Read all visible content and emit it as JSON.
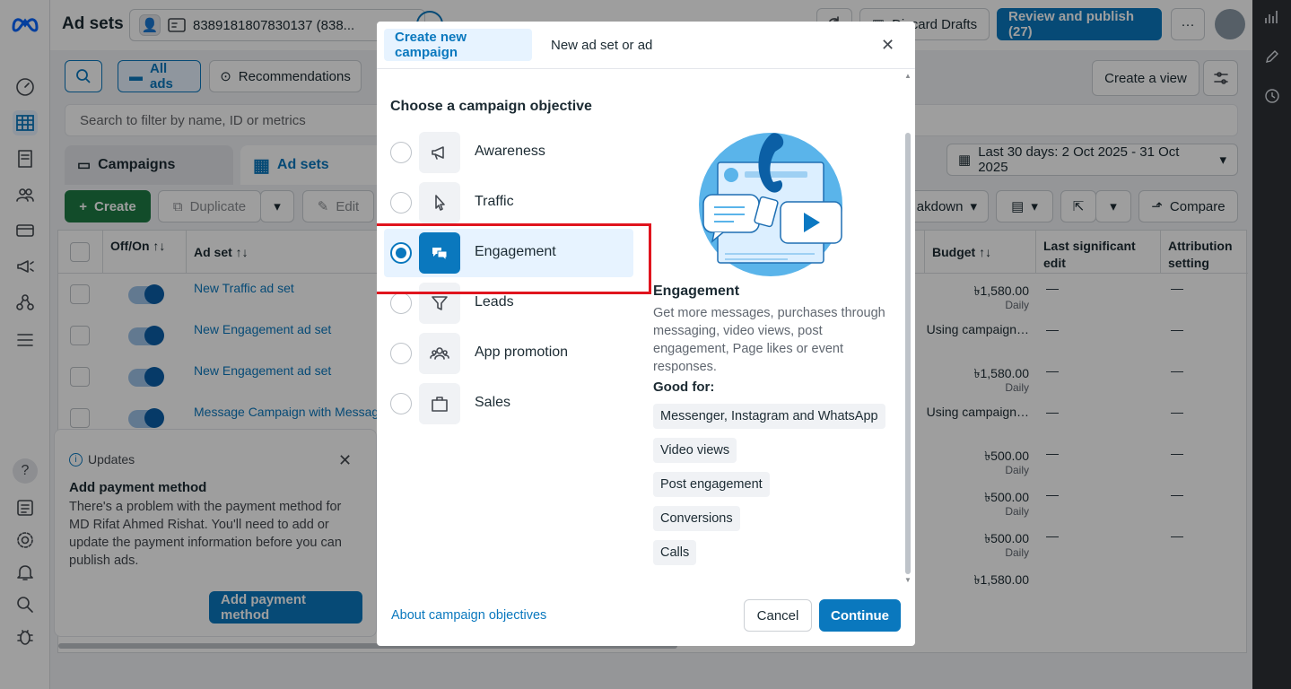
{
  "topbar": {
    "title": "Ad sets",
    "account_id": "8389181807830137 (838...",
    "discard_drafts": "Discard Drafts",
    "review_publish": "Review and publish (27)",
    "more": "···"
  },
  "toolbar": {
    "all_ads": "All ads",
    "recommendations": "Recommendations",
    "create_view": "Create a view",
    "search_placeholder": "Search to filter by name, ID or metrics"
  },
  "level_tabs": {
    "campaigns": "Campaigns",
    "ad_sets": "Ad sets"
  },
  "date_range": "Last 30 days: 2 Oct 2025 - 31 Oct 2025",
  "actions": {
    "create": "Create",
    "duplicate": "Duplicate",
    "edit": "Edit",
    "breakdown": "akdown",
    "compare": "Compare"
  },
  "table": {
    "headers": {
      "off_on": "Off/On ↑↓",
      "ad_set": "Ad set ↑↓",
      "budget": "Budget ↑↓",
      "last_edit": "Last significant edit",
      "attribution": "Attribution setting"
    },
    "rows": [
      {
        "name": "New Traffic ad set",
        "budget": "৳1,580.00",
        "budget_sub": "Daily",
        "last": "—",
        "attr": "—"
      },
      {
        "name": "New Engagement ad set",
        "budget": "Using campaign…",
        "budget_sub": "",
        "last": "—",
        "attr": "—"
      },
      {
        "name": "New Engagement ad set",
        "budget": "৳1,580.00",
        "budget_sub": "Daily",
        "last": "—",
        "attr": "—"
      },
      {
        "name": "Message Campaign with Messag",
        "budget": "Using campaign…",
        "budget_sub": "",
        "last": "—",
        "attr": "—"
      },
      {
        "name": "",
        "budget": "৳500.00",
        "budget_sub": "Daily",
        "last": "—",
        "attr": "—"
      },
      {
        "name": "",
        "budget": "৳500.00",
        "budget_sub": "Daily",
        "last": "—",
        "attr": "—"
      },
      {
        "name": "",
        "budget": "৳500.00",
        "budget_sub": "Daily",
        "last": "—",
        "attr": "—"
      },
      {
        "name": "",
        "budget": "৳1,580.00",
        "budget_sub": "",
        "last": "",
        "attr": ""
      }
    ]
  },
  "updates": {
    "header": "Updates",
    "title": "Add payment method",
    "body": "There's a problem with the payment method for MD Rifat Ahmed Rishat. You'll need to add or update the payment information before you can publish ads.",
    "button": "Add payment method"
  },
  "modal": {
    "tab_create": "Create new campaign",
    "tab_new_ad": "New ad set or ad",
    "heading": "Choose a campaign objective",
    "objectives": [
      {
        "label": "Awareness",
        "icon": "megaphone-icon",
        "selected": false
      },
      {
        "label": "Traffic",
        "icon": "cursor-icon",
        "selected": false
      },
      {
        "label": "Engagement",
        "icon": "chat-bubbles-icon",
        "selected": true
      },
      {
        "label": "Leads",
        "icon": "funnel-icon",
        "selected": false
      },
      {
        "label": "App promotion",
        "icon": "people-icon",
        "selected": false
      },
      {
        "label": "Sales",
        "icon": "shopping-bag-icon",
        "selected": false
      }
    ],
    "detail": {
      "title": "Engagement",
      "description": "Get more messages, purchases through messaging, video views, post engagement, Page likes or event responses.",
      "good_for": "Good for:",
      "chips": [
        "Messenger, Instagram and WhatsApp",
        "Video views",
        "Post engagement",
        "Conversions",
        "Calls"
      ]
    },
    "about_link": "About campaign objectives",
    "cancel": "Cancel",
    "continue": "Continue"
  },
  "colors": {
    "accent": "#0a78be",
    "green": "#1d7b45",
    "highlight_border": "#e0141e",
    "selected_bg": "#e7f3ff"
  }
}
